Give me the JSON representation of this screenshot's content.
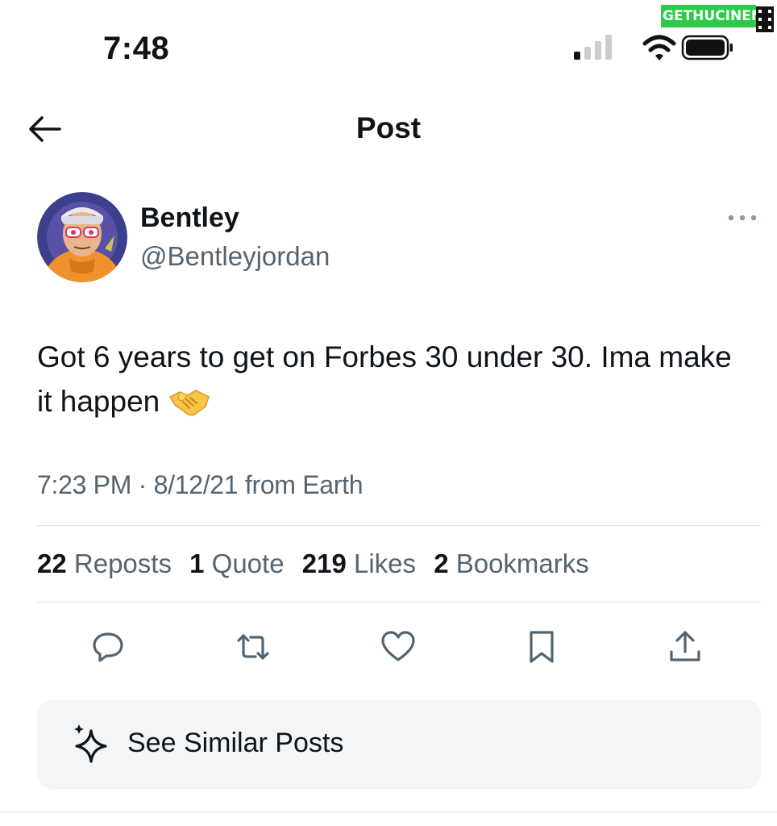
{
  "status_bar": {
    "time": "7:48"
  },
  "watermark": {
    "text": "GETHUCINEMA"
  },
  "header": {
    "title": "Post",
    "back_icon": "arrow-left-icon"
  },
  "author": {
    "name": "Bentley",
    "handle": "@Bentleyjordan",
    "avatar": "avatar-illustration"
  },
  "post": {
    "text": "Got 6 years to get on Forbes 30 under 30. Ima make it happen",
    "emoji": "handshake",
    "meta": "7:23 PM · 8/12/21 from Earth"
  },
  "stats": [
    {
      "count": "22",
      "label": "Reposts"
    },
    {
      "count": "1",
      "label": "Quote"
    },
    {
      "count": "219",
      "label": "Likes"
    },
    {
      "count": "2",
      "label": "Bookmarks"
    }
  ],
  "actions": [
    "reply-icon",
    "repost-icon",
    "like-icon",
    "bookmark-icon",
    "share-icon"
  ],
  "similar": {
    "label": "See Similar Posts",
    "icon": "sparkle-icon"
  },
  "colors": {
    "text": "#0f1419",
    "secondary": "#536471",
    "divider": "#dde3e8",
    "card_bg": "#f3f5f6",
    "watermark_bg": "#2fc94a"
  }
}
